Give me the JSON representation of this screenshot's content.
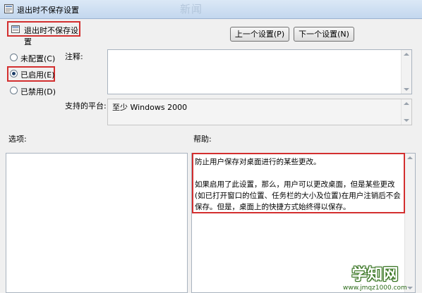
{
  "window": {
    "title": "退出时不保存设置",
    "background_text": "新闻"
  },
  "policy": {
    "name": "退出时不保存设置"
  },
  "nav": {
    "prev_label": "上一个设置(P)",
    "next_label": "下一个设置(N)"
  },
  "state": {
    "options": [
      {
        "label": "未配置(C)",
        "checked": false
      },
      {
        "label": "已启用(E)",
        "checked": true
      },
      {
        "label": "已禁用(D)",
        "checked": false
      }
    ]
  },
  "comment": {
    "label": "注释:",
    "value": ""
  },
  "platform": {
    "label": "支持的平台:",
    "value": "至少 Windows 2000"
  },
  "options_section": {
    "label": "选项:"
  },
  "help": {
    "label": "帮助:",
    "paragraph1": "防止用户保存对桌面进行的某些更改。",
    "paragraph2": "如果启用了此设置，那么，用户可以更改桌面，但是某些更改(如已打开窗口的位置、任务栏的大小及位置)在用户注销后不会保存。但是，桌面上的快捷方式始终得以保存。"
  },
  "watermark": {
    "main": "学知网",
    "sub": "www.jmqz1000.com"
  },
  "colors": {
    "highlight": "#d32f2f",
    "titlebar": "#c3d7ee",
    "watermark": "#2e6b1a"
  }
}
